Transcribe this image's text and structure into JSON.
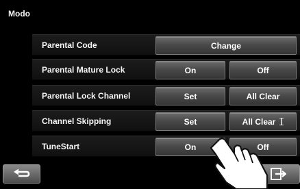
{
  "screen": {
    "title": "Modo"
  },
  "rows": [
    {
      "label": "Parental Code",
      "button": "Change"
    },
    {
      "label": "Parental Mature Lock",
      "left": "On",
      "right": "Off"
    },
    {
      "label": "Parental Lock Channel",
      "left": "Set",
      "right": "All Clear"
    },
    {
      "label": "Channel Skipping",
      "left": "Set",
      "right": "All Clear"
    },
    {
      "label": "TuneStart",
      "left": "On",
      "right": "Off"
    }
  ],
  "icons": {
    "back": "return-arrow-icon",
    "exit": "exit-door-icon",
    "hand": "pointing-hand-icon",
    "cursor": "text-cursor-icon"
  },
  "colors": {
    "background": "#000000",
    "button": "#555555",
    "text": "#ffffff"
  }
}
